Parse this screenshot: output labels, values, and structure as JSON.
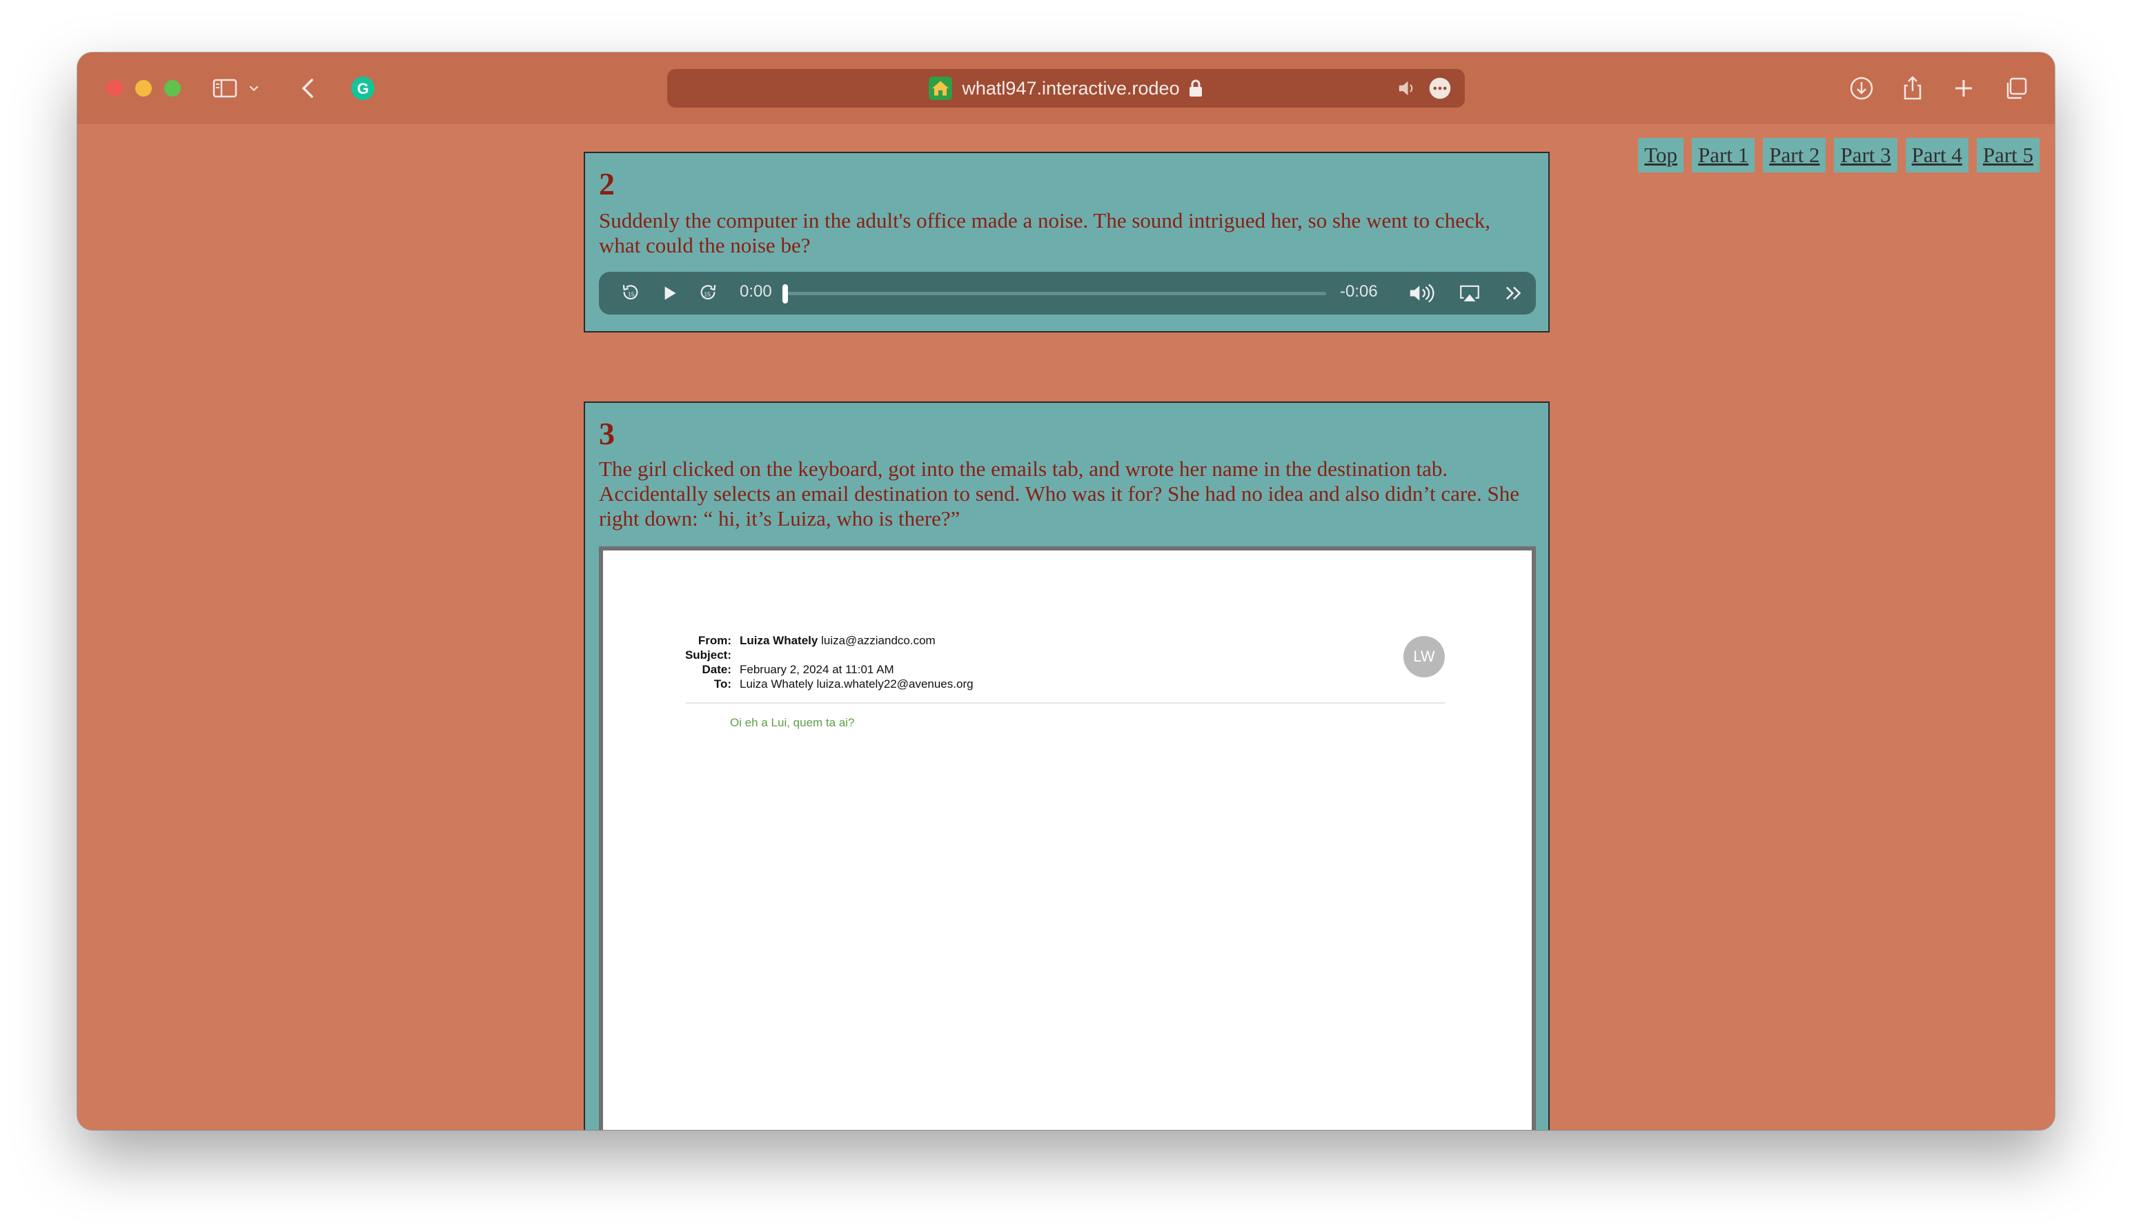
{
  "browser": {
    "url": "whatl947.interactive.rodeo",
    "icons": [
      "sidebar-icon",
      "chevron-down-icon",
      "back-icon",
      "grammarly-icon",
      "home-favicon",
      "lock-icon",
      "speaker-icon",
      "more-icon",
      "download-icon",
      "share-icon",
      "plus-icon",
      "tabs-icon"
    ]
  },
  "nav": {
    "links": [
      "Top",
      "Part 1",
      "Part 2",
      "Part 3",
      "Part 4",
      "Part 5"
    ]
  },
  "sections": [
    {
      "number": "2",
      "text": "Suddenly the computer in the adult's office made a noise. The sound intrigued her, so she went to check, what could the noise be?",
      "audio": {
        "elapsed": "0:00",
        "remaining": "-0:06",
        "progress": 0
      }
    },
    {
      "number": "3",
      "text": "The girl clicked on the keyboard, got into the emails tab, and wrote her name in the destination tab. Accidentally selects an email destination to send. Who was it for? She had no idea and also didn’t care. She right down: “ hi, it’s Luiza, who is there?”",
      "email": {
        "from_label": "From:",
        "from_name": "Luiza Whately",
        "from_addr": "luiza@azziandco.com",
        "subject_label": "Subject:",
        "subject": "",
        "date_label": "Date:",
        "date": "February 2, 2024 at 11:01 AM",
        "to_label": "To:",
        "to": "Luiza Whately luiza.whately22@avenues.org",
        "avatar": "LW",
        "body": "Oi eh a Lui, quem ta ai?"
      }
    }
  ],
  "colors": {
    "page_bg": "#cf7a5c",
    "toolbar": "#c56d4f",
    "card": "#6daeac",
    "text": "#8a1f12",
    "email_body_text": "#5e9e48"
  }
}
